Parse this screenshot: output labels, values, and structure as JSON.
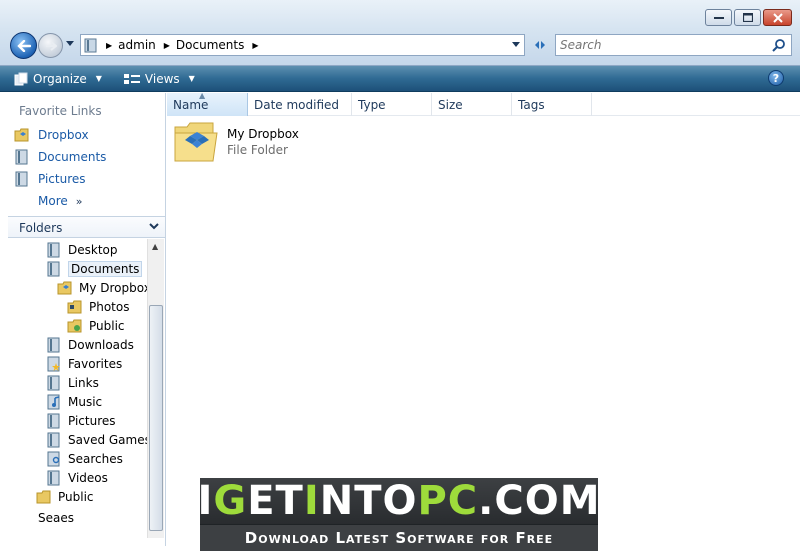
{
  "address": {
    "crumbs": [
      "admin",
      "Documents"
    ]
  },
  "search": {
    "placeholder": "Search"
  },
  "toolbar": {
    "organize": "Organize",
    "views": "Views",
    "help": "?"
  },
  "favorite_links": {
    "header": "Favorite Links",
    "items": [
      "Dropbox",
      "Documents",
      "Pictures"
    ],
    "more": "More"
  },
  "folders": {
    "header": "Folders",
    "tree": [
      {
        "label": "Desktop"
      },
      {
        "label": "Documents"
      },
      {
        "label": "My Dropbox"
      },
      {
        "label": "Photos"
      },
      {
        "label": "Public"
      },
      {
        "label": "Downloads"
      },
      {
        "label": "Favorites"
      },
      {
        "label": "Links"
      },
      {
        "label": "Music"
      },
      {
        "label": "Pictures"
      },
      {
        "label": "Saved Games"
      },
      {
        "label": "Searches"
      },
      {
        "label": "Videos"
      },
      {
        "label": "Public"
      },
      {
        "label": "Seaes"
      }
    ]
  },
  "columns": [
    "Name",
    "Date modified",
    "Type",
    "Size",
    "Tags"
  ],
  "files": [
    {
      "name": "My Dropbox",
      "type": "File Folder"
    }
  ],
  "watermark": {
    "brand_white_1": "I",
    "brand_green_1": "G",
    "brand_white_2": "ET",
    "brand_green_2": "I",
    "brand_white_3": "NTO",
    "brand_green_3": "PC",
    "brand_white_4": ".COM",
    "tagline": "Download Latest Software for Free"
  },
  "colors": {
    "accent": "#1a5aa6",
    "toolbar": "#2f6a93",
    "watermark_green": "#9edb3b"
  }
}
